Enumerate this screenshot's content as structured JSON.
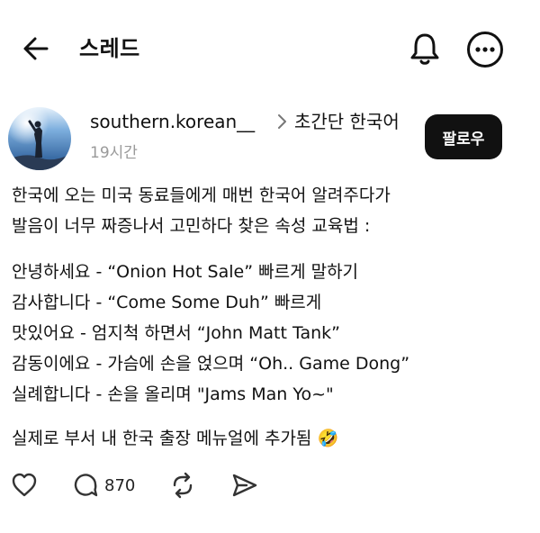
{
  "header": {
    "title": "스레드",
    "icons": [
      "back-arrow-icon",
      "bell-icon",
      "more-icon"
    ]
  },
  "post": {
    "author": {
      "username": "southern.korean__",
      "avatar": "avatar-photo"
    },
    "community": "초간단 한국어",
    "time": "19시간",
    "follow_label": "팔로우",
    "intro_lines": [
      "한국에 오는 미국 동료들에게 매번 한국어 알려주다가",
      "발음이 너무 짜증나서 고민하다 찾은 속성 교육법 :"
    ],
    "phrase_lines": [
      "안녕하세요 - “Onion Hot Sale” 빠르게 말하기",
      "감사합니다 - “Come Some Duh” 빠르게",
      "맛있어요 - 엄지척 하면서 “John Matt Tank”",
      "감동이에요 - 가슴에 손을 얹으며 “Oh.. Game Dong”",
      "실례합니다 - 손을 올리며 \"Jams Man Yo~\""
    ],
    "closing": "실제로 부서 내 한국 출장 메뉴얼에 추가됨",
    "closing_emoji": "🤣",
    "actions": {
      "reply_count": "870"
    }
  }
}
